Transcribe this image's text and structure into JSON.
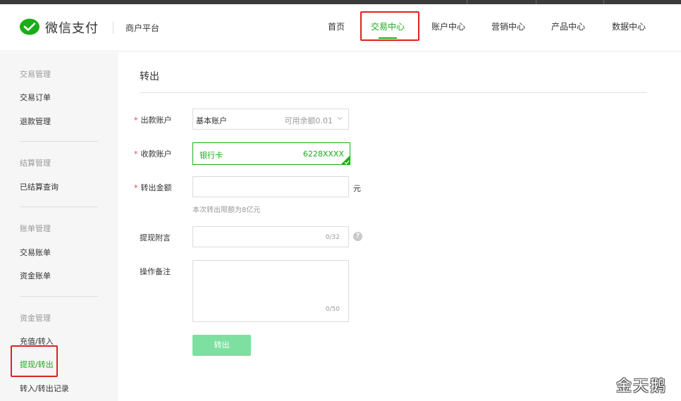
{
  "header": {
    "brand": "微信支付",
    "platform": "商户平台",
    "nav": [
      {
        "label": "首页"
      },
      {
        "label": "交易中心",
        "active": true
      },
      {
        "label": "账户中心"
      },
      {
        "label": "营销中心"
      },
      {
        "label": "产品中心"
      },
      {
        "label": "数据中心"
      }
    ]
  },
  "sidebar": {
    "groups": [
      {
        "title": "交易管理",
        "items": [
          "交易订单",
          "退款管理"
        ]
      },
      {
        "title": "结算管理",
        "items": [
          "已结算查询"
        ]
      },
      {
        "title": "账单管理",
        "items": [
          "交易账单",
          "资金账单"
        ]
      },
      {
        "title": "资金管理",
        "items": [
          "充值/转入",
          "提现/转出",
          "转入/转出记录"
        ]
      }
    ],
    "active_item": "提现/转出"
  },
  "form": {
    "title": "转出",
    "required_mark": "*",
    "payout_account": {
      "label": "出款账户",
      "value": "基本账户",
      "balance": "可用余额0.01"
    },
    "receive_account": {
      "label": "收款账户",
      "value": "银行卡",
      "card": "6228XXXX"
    },
    "amount": {
      "label": "转出金额",
      "unit": "元",
      "hint": "本次转出限额为8亿元"
    },
    "note": {
      "label": "提现附言",
      "counter": "0/32",
      "help": "?"
    },
    "remark": {
      "label": "操作备注",
      "counter": "0/50"
    },
    "submit_label": "转出"
  },
  "watermark": "金天鹅",
  "colors": {
    "accent": "#1aad19",
    "highlight": "#e02020",
    "button_disabled": "#7ee0a0"
  }
}
